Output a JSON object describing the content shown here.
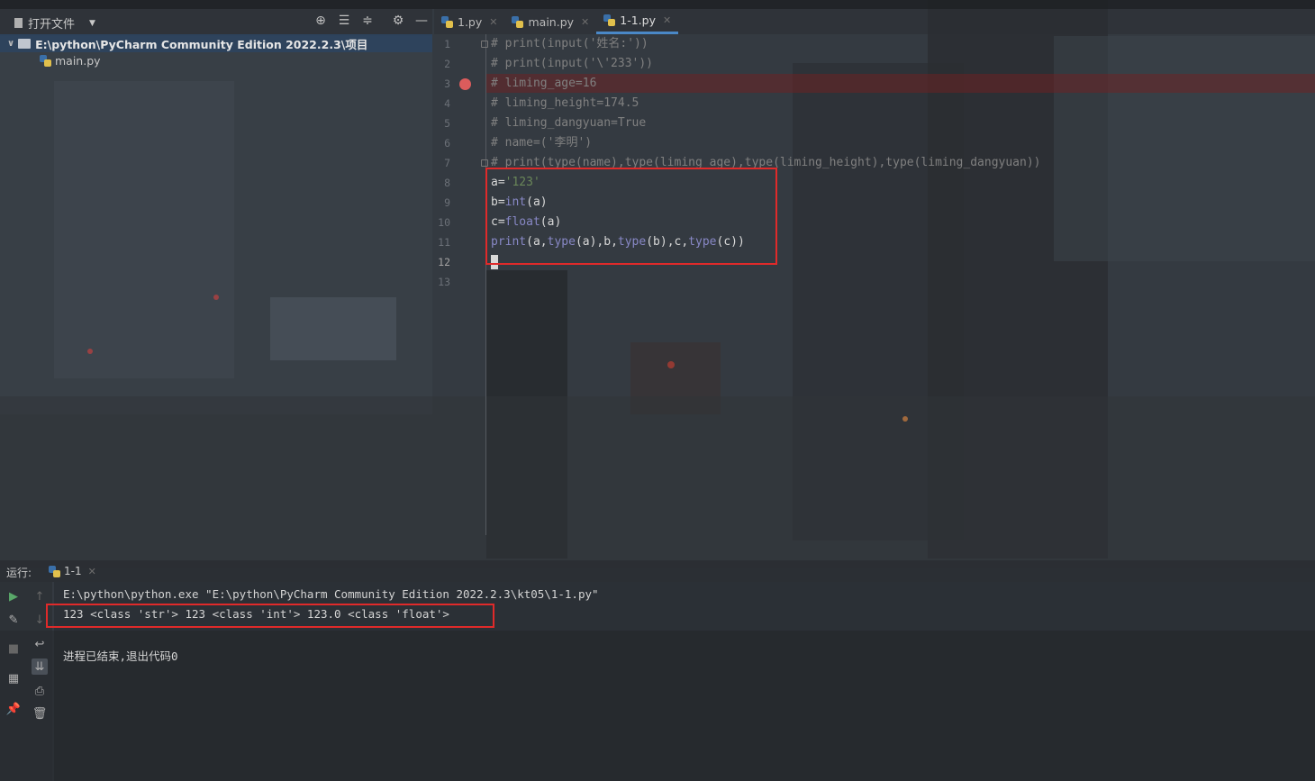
{
  "project": {
    "toolbar_title": "打开文件",
    "root_path": "E:\\python\\PyCharm Community Edition 2022.2.3\\项目",
    "files": [
      "main.py"
    ]
  },
  "tabs": [
    {
      "label": "1.py",
      "active": false
    },
    {
      "label": "main.py",
      "active": false
    },
    {
      "label": "1-1.py",
      "active": true
    }
  ],
  "editor": {
    "line_numbers": [
      "1",
      "2",
      "3",
      "4",
      "5",
      "6",
      "7",
      "8",
      "9",
      "10",
      "11",
      "12",
      "13"
    ],
    "current_line": "12",
    "breakpoint_line": "3",
    "lines": [
      "# print(input('姓名:'))",
      "# print(input('\\'233'))",
      "# liming_age=16",
      "# liming_height=174.5",
      "# liming_dangyuan=True",
      "# name=('李明')",
      "# print(type(name),type(liming_age),type(liming_height),type(liming_dangyuan))"
    ],
    "code_a": {
      "name": "a=",
      "value": "'123'"
    },
    "code_b": {
      "name": "b=",
      "fn": "int",
      "arg": "(a)"
    },
    "code_c": {
      "name": "c=",
      "fn": "float",
      "arg": "(a)"
    },
    "code_print": {
      "fn": "print",
      "open": "(a,",
      "type1": "type",
      "a1": "(a),b,",
      "type2": "type",
      "a2": "(b),c,",
      "type3": "type",
      "a3": "(c))"
    }
  },
  "run": {
    "label": "运行:",
    "tab_label": "1-1",
    "command": "E:\\python\\python.exe \"E:\\python\\PyCharm Community Edition 2022.2.3\\kt05\\1-1.py\"",
    "output": "123 <class 'str'> 123 <class 'int'> 123.0 <class 'float'>",
    "exit_message": "进程已结束,退出代码0"
  },
  "colors": {
    "keyword": "#8888c6",
    "string": "#6a8759",
    "comment": "#808080",
    "highlight_box": "#e02a2a",
    "breakpoint": "#db5c5c",
    "run_icon": "#59a869"
  },
  "icons": [
    "folder-icon",
    "python-file-icon",
    "locate-icon",
    "expand-all-icon",
    "collapse-all-icon",
    "gear-icon",
    "minimize-icon",
    "run-icon",
    "wrench-icon",
    "stop-icon",
    "layout-icon",
    "pin-icon",
    "up-arrow-icon",
    "down-arrow-icon",
    "soft-wrap-icon",
    "scroll-end-icon",
    "print-icon",
    "trash-icon",
    "dropdown-icon"
  ]
}
